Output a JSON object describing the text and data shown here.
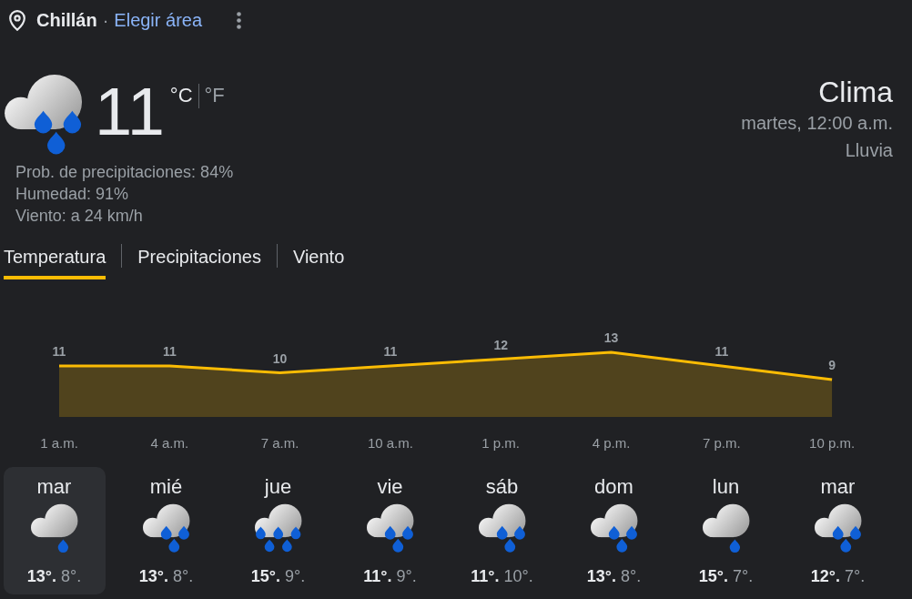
{
  "header": {
    "location": "Chillán",
    "separator": "·",
    "link": "Elegir área"
  },
  "current": {
    "kind": "rain",
    "temperature": "11",
    "units": [
      {
        "label": "°C",
        "selected": true
      },
      {
        "label": "°F",
        "selected": false
      }
    ],
    "details": [
      "Prob. de precipitaciones: 84%",
      "Humedad: 91%",
      "Viento: a 24 km/h"
    ]
  },
  "summary": {
    "title": "Clima",
    "time": "martes, 12:00 a.m.",
    "condition": "Lluvia"
  },
  "tabs": [
    {
      "label": "Temperatura",
      "selected": true
    },
    {
      "label": "Precipitaciones",
      "selected": false
    },
    {
      "label": "Viento",
      "selected": false
    }
  ],
  "chart": {
    "chart_data": {
      "type": "area",
      "categories": [
        "1 a.m.",
        "4 a.m.",
        "7 a.m.",
        "10 a.m.",
        "1 p.m.",
        "4 p.m.",
        "7 p.m.",
        "10 p.m."
      ],
      "values": [
        11,
        11,
        10,
        11,
        12,
        13,
        11,
        9
      ],
      "data_labels": true
    }
  },
  "days": [
    {
      "day": "mar",
      "kind": "drizzle",
      "high": "13°.",
      "low": "8°.",
      "selected": true
    },
    {
      "day": "mié",
      "kind": "rain",
      "high": "13°.",
      "low": "8°.",
      "selected": false
    },
    {
      "day": "jue",
      "kind": "downpour",
      "high": "15°.",
      "low": "9°.",
      "selected": false
    },
    {
      "day": "vie",
      "kind": "rain",
      "high": "11°.",
      "low": "9°.",
      "selected": false
    },
    {
      "day": "sáb",
      "kind": "rain",
      "high": "11°.",
      "low": "10°.",
      "selected": false
    },
    {
      "day": "dom",
      "kind": "rain",
      "high": "13°.",
      "low": "8°.",
      "selected": false
    },
    {
      "day": "lun",
      "kind": "drizzle",
      "high": "15°.",
      "low": "7°.",
      "selected": false
    },
    {
      "day": "mar",
      "kind": "rain",
      "high": "12°.",
      "low": "7°.",
      "selected": false
    }
  ]
}
